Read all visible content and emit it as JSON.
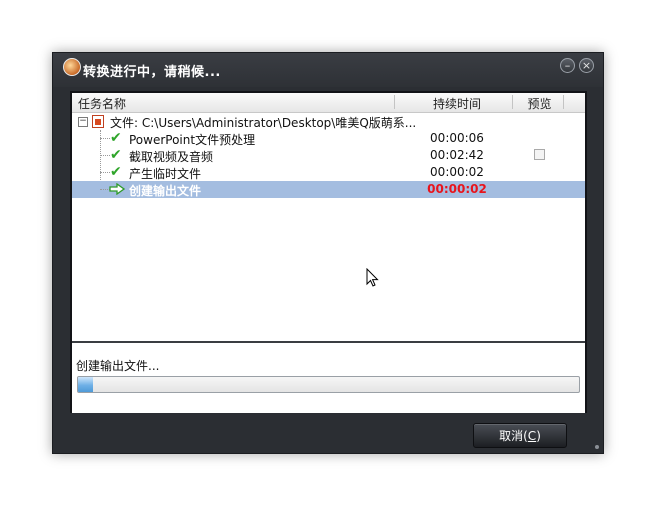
{
  "window": {
    "title": "转换进行中，请稍候...",
    "minimize_glyph": "–",
    "close_glyph": "×"
  },
  "list": {
    "columns": [
      "任务名称",
      "持续时间",
      "预览"
    ],
    "root": {
      "expander": "−",
      "label": "文件: C:\\Users\\Administrator\\Desktop\\唯美Q版萌系..."
    },
    "tasks": [
      {
        "label": "PowerPoint文件预处理",
        "time": "00:00:06",
        "status": "done",
        "icon": "check-icon"
      },
      {
        "label": "截取视频及音频",
        "time": "00:02:42",
        "status": "done",
        "icon": "check-icon",
        "preview_checkbox": true
      },
      {
        "label": "产生临时文件",
        "time": "00:00:02",
        "status": "done",
        "icon": "check-icon"
      },
      {
        "label": "创建输出文件",
        "time": "00:00:02",
        "status": "in-progress",
        "icon": "arrow-right-icon"
      }
    ]
  },
  "status": {
    "text": "创建输出文件...",
    "progress": 0.03
  },
  "buttons": {
    "cancel_label": "取消(",
    "cancel_accel": "C",
    "cancel_suffix": ")"
  },
  "colors": {
    "selection": "#a4bde0",
    "active_time": "#e8141c",
    "check": "#2fa52a",
    "progress": "#6fb0e6"
  }
}
